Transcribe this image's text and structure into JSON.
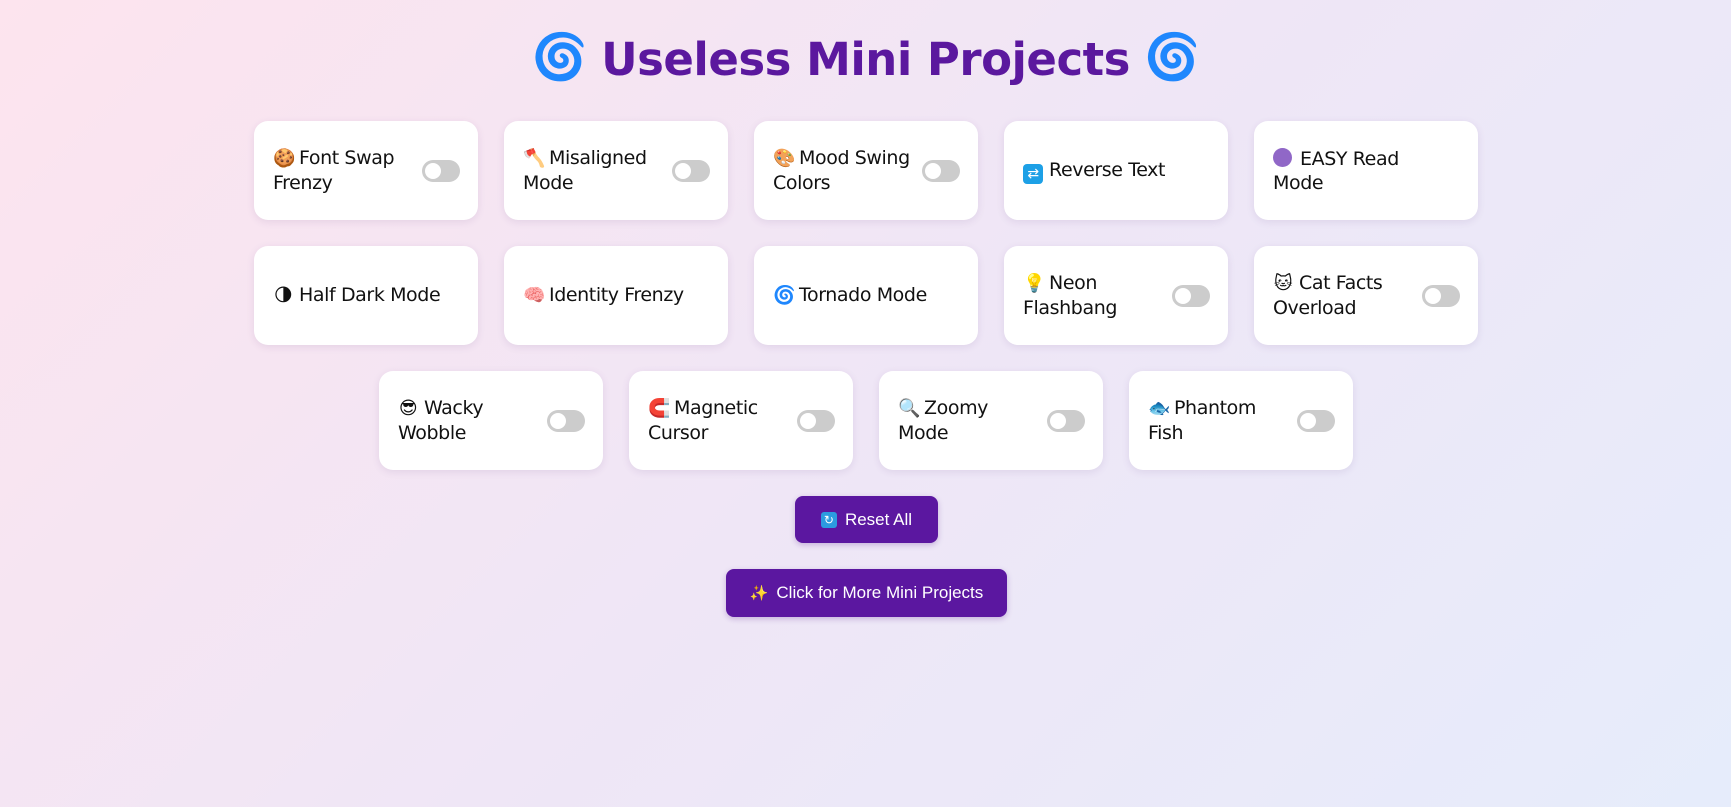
{
  "header": {
    "title": "Useless Mini Projects",
    "left_icon": "🌀",
    "right_icon": "🌀"
  },
  "cards": [
    {
      "id": "font-swap-frenzy",
      "icon": "🍪",
      "line1": "Font Swap",
      "line2": "Frenzy",
      "has_toggle": true
    },
    {
      "id": "misaligned-mode",
      "icon": "🪓",
      "line1": "Misaligned",
      "line2": "Mode",
      "has_toggle": true
    },
    {
      "id": "mood-swing-colors",
      "icon": "🎨",
      "line1": "Mood Swing",
      "line2": "Colors",
      "has_toggle": true
    },
    {
      "id": "reverse-text",
      "icon": "🔁",
      "line1": "Reverse Text",
      "line2": "",
      "has_toggle": false
    },
    {
      "id": "easy-read-mode",
      "icon": "🟣",
      "line1": "EASY Read",
      "line2": "Mode",
      "has_toggle": false
    },
    {
      "id": "half-dark-mode",
      "icon": "🌗",
      "line1": "Half Dark Mode",
      "line2": "",
      "has_toggle": false
    },
    {
      "id": "identity-frenzy",
      "icon": "🧠",
      "line1": "Identity Frenzy",
      "line2": "",
      "has_toggle": false
    },
    {
      "id": "tornado-mode",
      "icon": "🌀",
      "line1": "Tornado Mode",
      "line2": "",
      "has_toggle": false
    },
    {
      "id": "neon-flashbang",
      "icon": "💡",
      "line1": "Neon",
      "line2": "Flashbang",
      "has_toggle": true
    },
    {
      "id": "cat-facts-overload",
      "icon": "🐱",
      "line1": "Cat Facts",
      "line2": "Overload",
      "has_toggle": true
    },
    {
      "id": "wacky-wobble",
      "icon": "😎",
      "line1": "Wacky",
      "line2": "Wobble",
      "has_toggle": true
    },
    {
      "id": "magnetic-cursor",
      "icon": "🧲",
      "line1": "Magnetic",
      "line2": "Cursor",
      "has_toggle": true
    },
    {
      "id": "zoomy-mode",
      "icon": "🔍",
      "line1": "Zoomy",
      "line2": "Mode",
      "has_toggle": true
    },
    {
      "id": "phantom-fish",
      "icon": "🐟",
      "line1": "Phantom",
      "line2": "Fish",
      "has_toggle": true
    }
  ],
  "buttons": {
    "reset_icon": "🔄",
    "reset_label": "Reset All",
    "more_icon": "✨",
    "more_label": "Click for More Mini Projects"
  },
  "colors": {
    "accent": "#5b17a0",
    "title": "#5b189e",
    "toggle_off": "#cccccc",
    "card": "#ffffff"
  }
}
